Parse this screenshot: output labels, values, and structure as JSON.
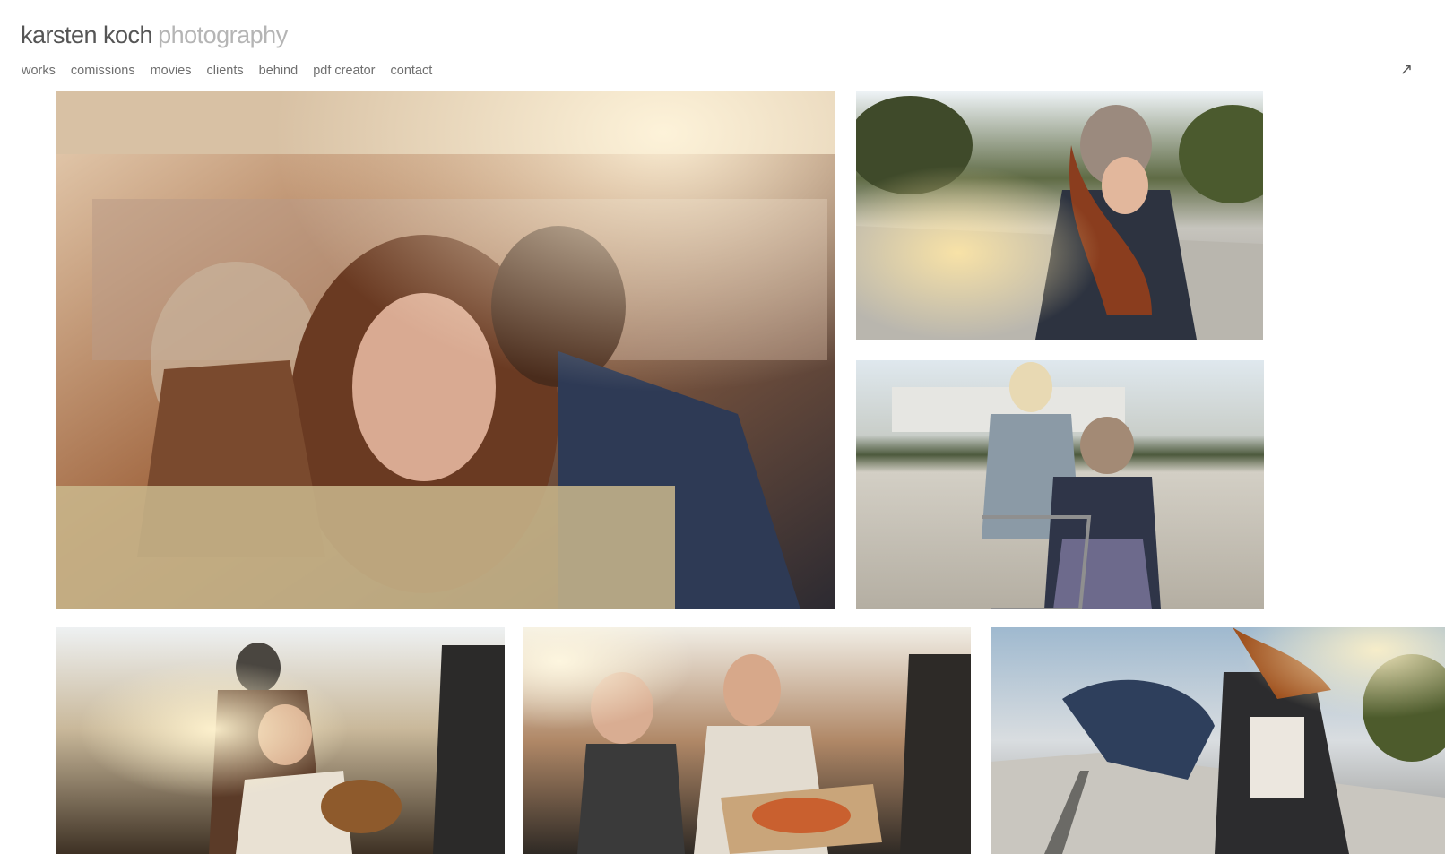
{
  "site": {
    "name": "karsten koch",
    "subtitle": "photography"
  },
  "nav": {
    "items": [
      {
        "label": "works"
      },
      {
        "label": "comissions"
      },
      {
        "label": "movies"
      },
      {
        "label": "clients"
      },
      {
        "label": "behind"
      },
      {
        "label": "pdf creator"
      },
      {
        "label": "contact"
      }
    ]
  },
  "controls": {
    "expand_icon": "↗"
  },
  "icons": {
    "expand": "diagonal-arrow-icon"
  },
  "colors": {
    "name_text": "#555555",
    "subtitle_text": "#b5b5b5",
    "nav_text": "#6f6f6f"
  },
  "gallery": [
    {
      "name": "photo-car-portrait"
    },
    {
      "name": "photo-bridge-couple"
    },
    {
      "name": "photo-shopping-cart"
    },
    {
      "name": "photo-rooftop-guitar"
    },
    {
      "name": "photo-rooftop-pizza"
    },
    {
      "name": "photo-bridge-jump"
    }
  ]
}
